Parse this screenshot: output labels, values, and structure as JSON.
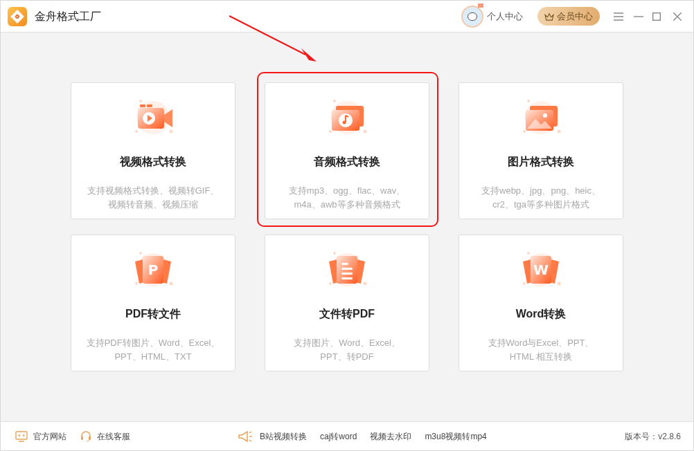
{
  "window": {
    "title": "金舟格式工厂"
  },
  "header": {
    "user_center": "个人中心",
    "vip_button": "会员中心"
  },
  "cards": [
    {
      "kind": "video",
      "title": "视频格式转换",
      "desc_lines": [
        "支持视频格式转换、视频转GIF、",
        "视频转音频、视频压缩"
      ],
      "highlighted": false
    },
    {
      "kind": "audio",
      "title": "音频格式转换",
      "desc_lines": [
        "支持mp3、ogg、flac、wav、",
        "m4a、awb等多种音频格式"
      ],
      "highlighted": true
    },
    {
      "kind": "image",
      "title": "图片格式转换",
      "desc_lines": [
        "支持webp、jpg、png、heic、",
        "cr2、tga等多种图片格式"
      ],
      "highlighted": false
    },
    {
      "kind": "letter",
      "icon_text": "P",
      "title": "PDF转文件",
      "desc_lines": [
        "支持PDF转图片、Word、Excel、",
        "PPT、HTML、TXT"
      ],
      "highlighted": false
    },
    {
      "kind": "document",
      "title": "文件转PDF",
      "desc_lines": [
        "支持图片、Word、Excel、",
        "PPT、转PDF"
      ],
      "highlighted": false
    },
    {
      "kind": "letter",
      "icon_text": "W",
      "title": "Word转换",
      "desc_lines": [
        "支持Word与Excel、PPT、",
        "HTML 相互转换"
      ],
      "highlighted": false
    }
  ],
  "footer": {
    "links_left": [
      {
        "kind": "website",
        "label": "官方网站"
      },
      {
        "kind": "support",
        "label": "在线客服"
      }
    ],
    "quick_links": [
      "B站视频转换",
      "caj转word",
      "视频去水印",
      "m3u8视频转mp4"
    ],
    "version": "版本号：v2.8.6"
  }
}
